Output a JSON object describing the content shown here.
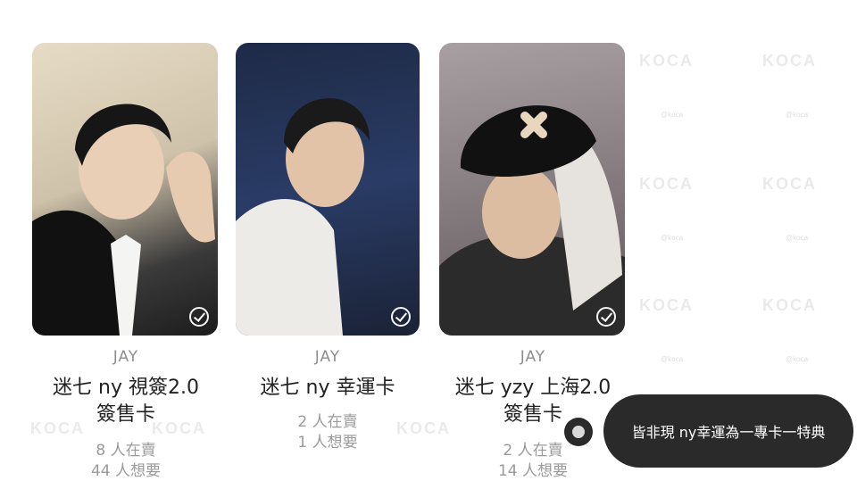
{
  "watermark": {
    "text": "KOCA",
    "small_text": "@koca"
  },
  "cards": [
    {
      "artist": "JAY",
      "title_line1": "迷七 ny 視簽2.0",
      "title_line2": "簽售卡",
      "selling": "8 人在賣",
      "wanting": "44 人想要",
      "photo_bg": "#d8ccb8",
      "icon": "check-circle-icon"
    },
    {
      "artist": "JAY",
      "title_line1": "迷七 ny 幸運卡",
      "title_line2": "",
      "selling": "2 人在賣",
      "wanting": "1 人想要",
      "photo_bg": "#24304c",
      "icon": "check-circle-icon"
    },
    {
      "artist": "JAY",
      "title_line1": "迷七 yzy 上海2.0",
      "title_line2": "簽售卡",
      "selling": "2 人在賣",
      "wanting": "14 人想要",
      "photo_bg": "#7a7074",
      "icon": "check-circle-icon"
    }
  ],
  "toast": {
    "text": "皆非現 ny幸運為一專卡一特典"
  }
}
